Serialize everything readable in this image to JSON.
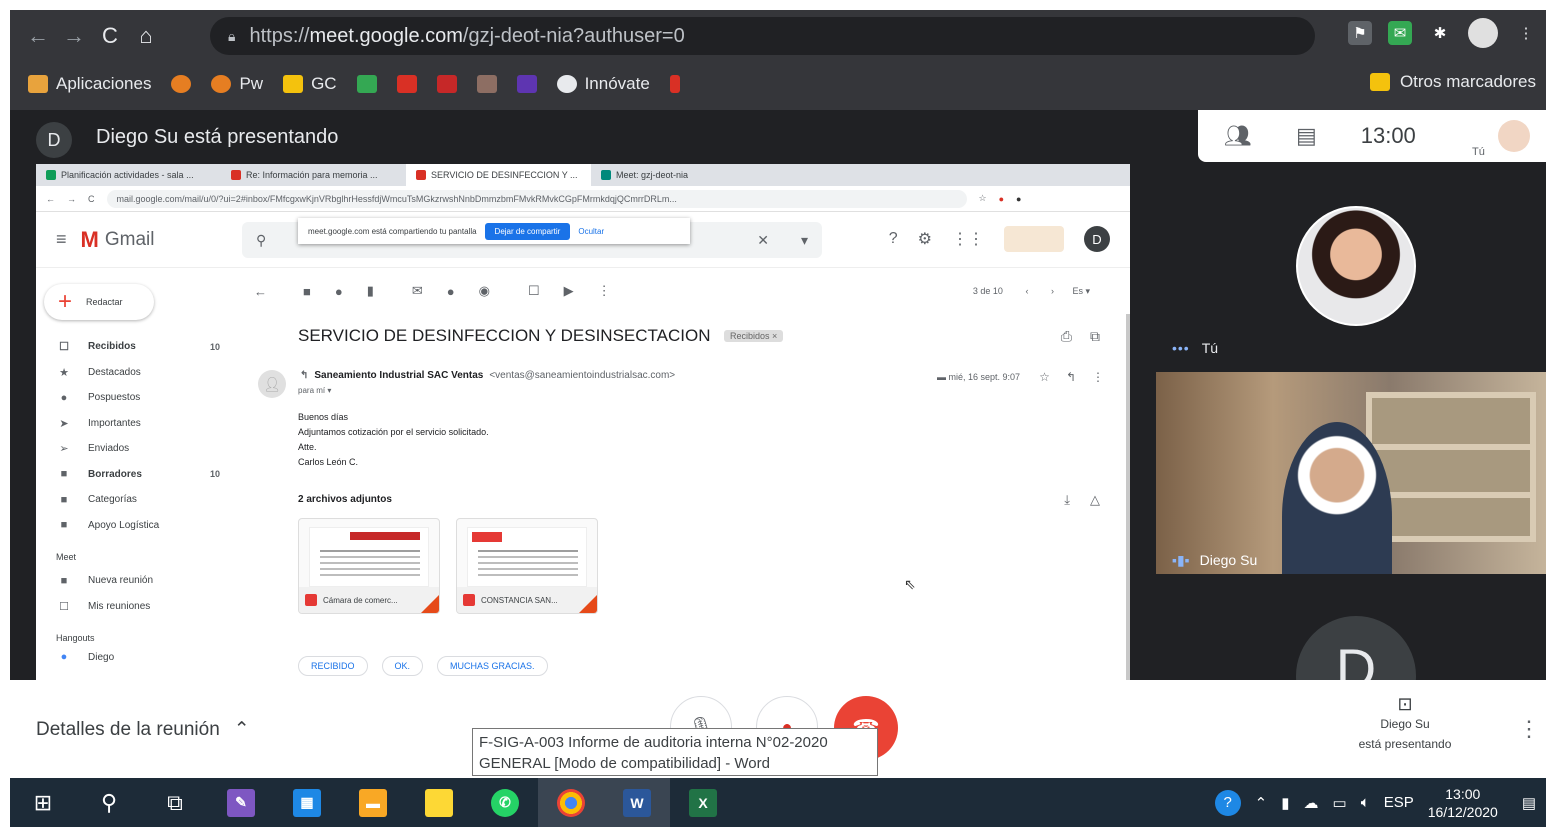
{
  "browser": {
    "url_prefix": "https://",
    "url_host": "meet.google.com",
    "url_path": "/gzj-deot-nia?authuser=0",
    "bookmarks": [
      {
        "label": "Aplicaciones",
        "color": "#e8a33d"
      },
      {
        "label": "",
        "color": "#e67e22"
      },
      {
        "label": "Pw",
        "color": "#e67e22"
      },
      {
        "label": "GC",
        "color": "#f4c20d"
      },
      {
        "label": "",
        "color": "#34a853"
      },
      {
        "label": "",
        "color": "#d93025"
      },
      {
        "label": "",
        "color": "#c62828"
      },
      {
        "label": "",
        "color": "#8d6e63"
      },
      {
        "label": "",
        "color": "#5e35b1"
      },
      {
        "label": "Innóvate",
        "color": "#e8eaed"
      },
      {
        "label": "",
        "color": "#d93025"
      }
    ],
    "other_bookmarks": "Otros marcadores"
  },
  "meet": {
    "presenter_initial": "D",
    "presenter_text": "Diego Su está presentando",
    "time": "13:00",
    "self_label_small": "Tú",
    "self_name": "Tú",
    "participant_name": "Diego Su",
    "participant_initial": "D",
    "details_label": "Detalles de la reunión",
    "presenting_line1": "Diego Su",
    "presenting_line2": "está presentando"
  },
  "shared": {
    "tabs": [
      {
        "label": "Planificación actividades - sala ...",
        "color": "#0f9d58"
      },
      {
        "label": "Re: Información para memoria ...",
        "color": "#d93025"
      },
      {
        "label": "SERVICIO DE DESINFECCION Y ...",
        "color": "#d93025"
      },
      {
        "label": "Meet: gzj-deot-nia",
        "color": "#00897b"
      }
    ],
    "url": "mail.google.com/mail/u/0/?ui=2#inbox/FMfcgxwKjnVRbglhrHessfdjWmcuTsMGkzrwshNnbDmmzbmFMvkRMvkCGpFMrmkdqjQCmrrDRLm...",
    "gmail_label": "Gmail",
    "share_notice": "meet.google.com está compartiendo tu pantalla",
    "share_stop": "Dejar de compartir",
    "share_hide": "Ocultar",
    "compose": "Redactar",
    "sidebar": [
      {
        "label": "Recibidos",
        "count": "10",
        "bold": true,
        "icon": "inbox-icon",
        "glyph": "☐"
      },
      {
        "label": "Destacados",
        "count": "",
        "bold": false,
        "icon": "star-icon",
        "glyph": "★"
      },
      {
        "label": "Pospuestos",
        "count": "",
        "bold": false,
        "icon": "clock-icon",
        "glyph": "●"
      },
      {
        "label": "Importantes",
        "count": "",
        "bold": false,
        "icon": "important-icon",
        "glyph": "➤"
      },
      {
        "label": "Enviados",
        "count": "",
        "bold": false,
        "icon": "send-icon",
        "glyph": "➢"
      },
      {
        "label": "Borradores",
        "count": "10",
        "bold": true,
        "icon": "draft-icon",
        "glyph": "■"
      },
      {
        "label": "Categorías",
        "count": "",
        "bold": false,
        "icon": "label-icon",
        "glyph": "■"
      },
      {
        "label": "Apoyo Logística",
        "count": "",
        "bold": false,
        "icon": "label-icon",
        "glyph": "■"
      }
    ],
    "meet_section": "Meet",
    "meet_items": [
      {
        "label": "Nueva reunión",
        "glyph": "■"
      },
      {
        "label": "Mis reuniones",
        "glyph": "☐"
      }
    ],
    "hangouts_section": "Hangouts",
    "hangouts_user": "Diego",
    "pager": "3 de 10",
    "subject": "SERVICIO DE DESINFECCION Y DESINSECTACION",
    "label_chip": "Recibidos ×",
    "sender": "Saneamiento Industrial SAC Ventas",
    "sender_email": "<ventas@saneamientoindustrialsac.com>",
    "to_me": "para mí ▾",
    "date": "mié, 16 sept. 9:07",
    "body": [
      "Buenos días",
      "Adjuntamos cotización por el servicio solicitado.",
      "Atte.",
      "Carlos León C."
    ],
    "attach_title": "2 archivos adjuntos",
    "attachments": [
      {
        "name": "Cámara de comerc..."
      },
      {
        "name": "CONSTANCIA SAN..."
      }
    ],
    "replies": [
      "RECIBIDO",
      "OK.",
      "MUCHAS GRACIAS."
    ]
  },
  "tooltip": {
    "line1": "F-SIG-A-003 Informe de auditoria interna N°02-2020",
    "line2": "GENERAL [Modo de compatibilidad] - Word"
  },
  "taskbar": {
    "lang": "ESP",
    "time": "13:00",
    "date": "16/12/2020",
    "word_label": "W",
    "excel_label": "X"
  }
}
